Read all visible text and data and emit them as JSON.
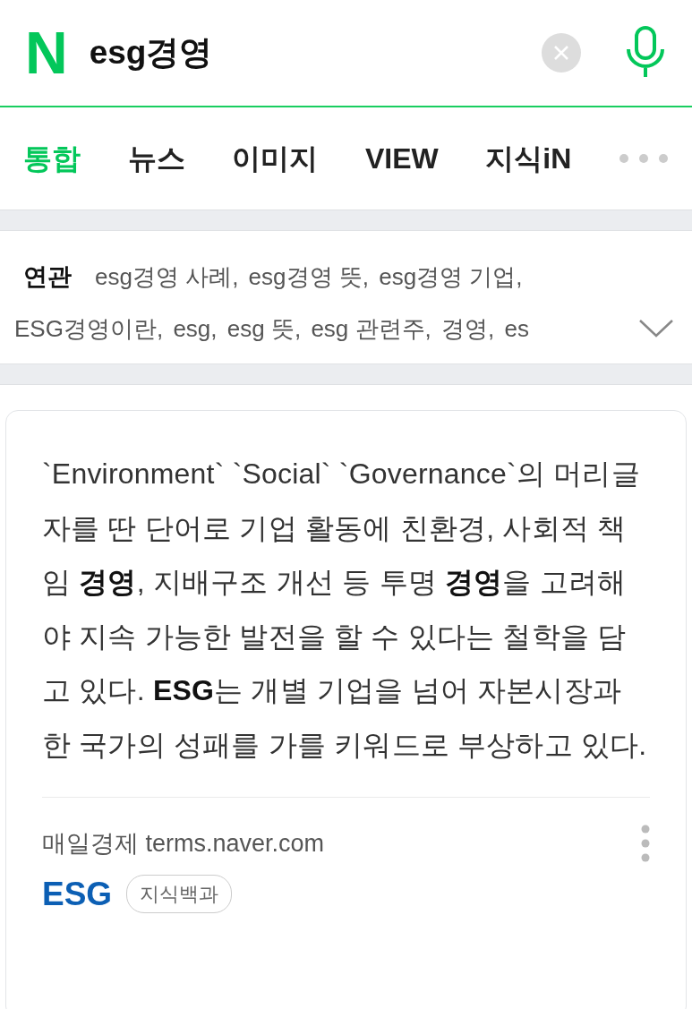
{
  "search": {
    "logo": "N",
    "query": "esg경영"
  },
  "tabs": [
    {
      "label": "통합",
      "selected": true
    },
    {
      "label": "뉴스",
      "selected": false
    },
    {
      "label": "이미지",
      "selected": false
    },
    {
      "label": "VIEW",
      "selected": false
    },
    {
      "label": "지식iN",
      "selected": false
    }
  ],
  "related": {
    "label": "연관",
    "items": [
      "esg경영 사례,",
      "esg경영 뜻,",
      "esg경영 기업,",
      "ESG경영이란,",
      "esg,",
      "esg 뜻,",
      "esg 관련주,",
      "경영,",
      "es"
    ]
  },
  "result": {
    "text": "`Environment` `Social` `Governance`의 머리글자를 딴 단어로 기업 활동에 친환경, 사회적 책임 **경영**, 지배구조 개선 등 투명 **경영**을 고려해야 지속 가능한 발전을 할 수 있다는 철학을 담고 있다. **ESG**는 개별 기업을 넘어 자본시장과 한 국가의 성패를 가를 키워드로 부상하고 있다.",
    "source": "매일경제",
    "url": "terms.naver.com",
    "title": "ESG",
    "badge": "지식백과"
  }
}
